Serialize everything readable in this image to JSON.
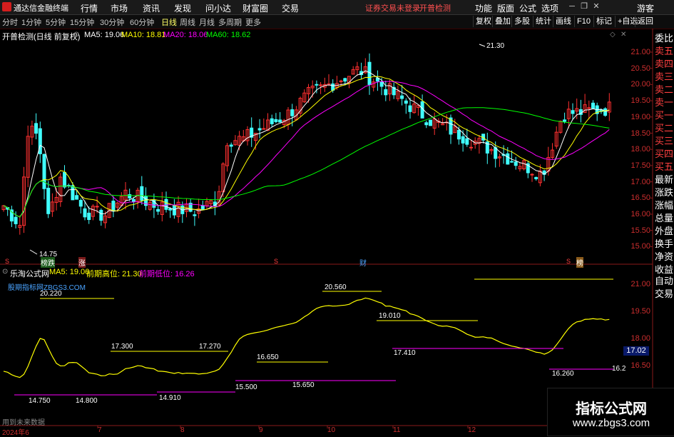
{
  "menubar": {
    "app_title": "通达信金融终端",
    "menus": [
      "行情",
      "市场",
      "资讯",
      "发现",
      "问小达",
      "财富圈",
      "交易"
    ],
    "login_warning": "证券交易未登录",
    "open_check": "开普检测",
    "right_menus": [
      "功能",
      "版面",
      "公式",
      "选项"
    ],
    "guest": "游客"
  },
  "periodbar": {
    "periods": [
      "分时",
      "1分钟",
      "5分钟",
      "15分钟",
      "30分钟",
      "60分钟",
      "日线",
      "周线",
      "月线",
      "多周期",
      "更多"
    ],
    "active_period": "日线",
    "tools": [
      "复权",
      "叠加",
      "多股",
      "统计",
      "画线",
      "F10",
      "标记",
      "+自选",
      "返回"
    ]
  },
  "main_chart": {
    "title": "开普检测(日线 前复权)",
    "ma_legend": [
      {
        "label": "MA5: 19.06",
        "color": "#ffffff"
      },
      {
        "label": "MA10: 18.81",
        "color": "#ffff00"
      },
      {
        "label": "MA20: 18.06",
        "color": "#ff00ff"
      },
      {
        "label": "MA60: 18.62",
        "color": "#00ff00"
      }
    ],
    "high_label": "21.30",
    "low_label": "14.75",
    "y_ticks": [
      "21.00",
      "20.50",
      "20.00",
      "19.50",
      "19.00",
      "18.50",
      "18.00",
      "17.50",
      "17.00",
      "16.50",
      "16.00",
      "15.50",
      "15.00"
    ],
    "markers": [
      "S",
      "榜跌",
      "涨",
      "S",
      "财",
      "S",
      "榜"
    ]
  },
  "sub_chart": {
    "title": "乐淘公式网",
    "legend": [
      {
        "label": "MA5: 19.06",
        "color": "#ffff00"
      },
      {
        "label": "前期高位: 21.30",
        "color": "#ffff00"
      },
      {
        "label": "前期低位: 16.26",
        "color": "#ff00ff"
      }
    ],
    "site_label": "股期指标网ZBGS3.COM",
    "y_ticks": [
      "21.00",
      "19.50",
      "18.00",
      "16.50"
    ],
    "current_value": "17.02",
    "levels_high": [
      "20.220",
      "20.560",
      "19.010",
      "17.300",
      "17.270",
      "16.650",
      "17.410"
    ],
    "levels_low": [
      "14.750",
      "14.800",
      "14.910",
      "15.500",
      "15.650",
      "16.260",
      "16.2"
    ],
    "x_axis": [
      "2024年6",
      "7",
      "8",
      "9",
      "10",
      "11",
      "12"
    ],
    "future_label": "用到未来数据"
  },
  "side_panel": {
    "items": [
      "委比",
      "卖五",
      "卖四",
      "卖三",
      "卖二",
      "卖一",
      "买一",
      "买二",
      "买三",
      "买四",
      "买五",
      "最新",
      "涨跌",
      "涨幅",
      "总量",
      "外盘",
      "换手",
      "净资",
      "收益",
      "自动",
      "交易"
    ]
  },
  "watermark": {
    "title": "指标公式网",
    "url": "www.zbgs3.com"
  }
}
